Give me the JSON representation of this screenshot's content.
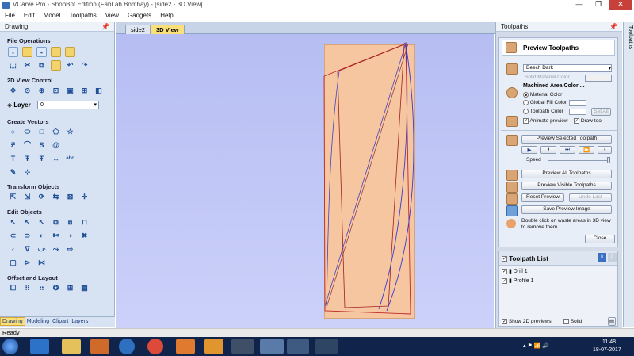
{
  "titlebar": {
    "title": "VCarve Pro - ShopBot Edition (FabLab Bombay) - [side2 - 3D View]",
    "min": "—",
    "max": "❐",
    "close": "✕"
  },
  "menu": [
    "File",
    "Edit",
    "Model",
    "Toolpaths",
    "View",
    "Gadgets",
    "Help"
  ],
  "left_panel": {
    "header": "Drawing",
    "pin": "📌",
    "sections": {
      "file_ops": "File Operations",
      "view_ctrl": "2D View Control",
      "layer": "Layer",
      "layer_value": "0",
      "create_vectors": "Create Vectors",
      "transform": "Transform Objects",
      "edit": "Edit Objects",
      "offset": "Offset and Layout"
    },
    "bottom_tabs": [
      "Drawing",
      "Modeling",
      "Clipart",
      "Layers"
    ]
  },
  "doc_tabs": [
    "side2",
    "3D View"
  ],
  "toolpaths_panel": {
    "header": "Toolpaths",
    "pin": "📌",
    "side_tab": "Toolpaths",
    "preview_title": "Preview Toolpaths",
    "material": "Beech Dark",
    "solid_color": "Solid Material Color",
    "machined_area": "Machined Area Color ...",
    "radio_material": "Material Color",
    "radio_global": "Global Fill Color",
    "radio_toolpath": "Toolpath Color",
    "set_all": "Set All",
    "animate": "Animate preview",
    "draw_tool": "Draw tool",
    "preview_selected": "Preview Selected Toolpath",
    "speed": "Speed",
    "preview_all": "Preview All Toolpaths",
    "preview_visible": "Preview Visible Toolpaths",
    "reset": "Reset Preview",
    "undo_last": "Undo Last",
    "save_image": "Save Preview Image",
    "hint": "Double click on waste areas in 3D view to remove them.",
    "close": "Close"
  },
  "toolpath_list": {
    "title": "Toolpath List",
    "items": [
      "Drill 1",
      "Profile 1"
    ],
    "show2d": "Show 2D previews",
    "solid": "Solid"
  },
  "status": "Ready",
  "clock": {
    "time": "11:48",
    "date": "18-07-2017"
  },
  "colors": {
    "board": "#f5c69f",
    "viewport_bg": "#c2c8f6",
    "taskbar": "#10234a",
    "toolpath_red": "#c0282a",
    "toolpath_blue": "#3a3ad0"
  }
}
